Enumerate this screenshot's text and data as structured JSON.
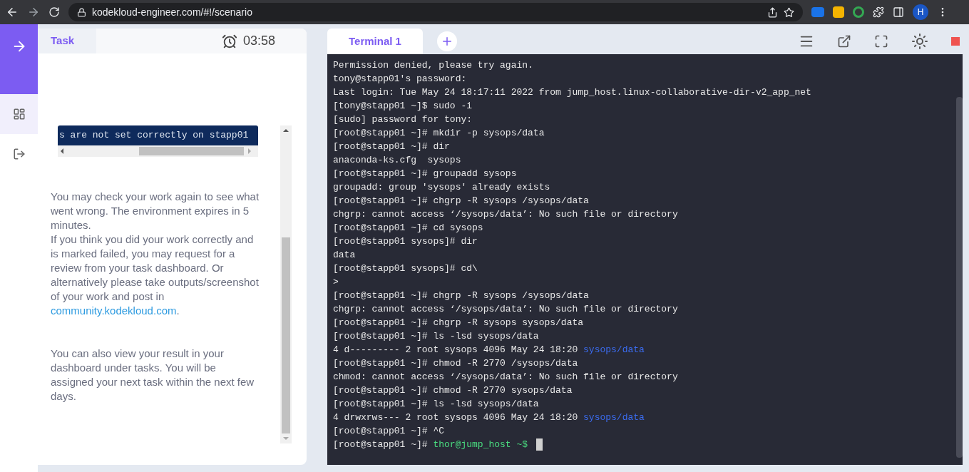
{
  "browser": {
    "url": "kodekloud-engineer.com/#!/scenario",
    "profile_initial": "H"
  },
  "task_panel": {
    "tab": {
      "label": "Task",
      "selected": true
    },
    "timer": "03:58",
    "code_snippet": "s are not set correctly on stapp01",
    "paragraph_groups": [
      [
        {
          "segments": [
            {
              "text": "You may check your work again to see what went wrong. The environment expires in 5 minutes.",
              "kind": "text"
            }
          ]
        },
        {
          "segments": [
            {
              "text": "If you think you did your work correctly and is marked failed, you may request for a review from your task dashboard. Or alternatively please take outputs/screenshot of your work and post in ",
              "kind": "text"
            },
            {
              "text": "community.kodekloud.com",
              "kind": "link"
            },
            {
              "text": ".",
              "kind": "text"
            }
          ]
        }
      ],
      [
        {
          "segments": [
            {
              "text": "You can also view your result in your dashboard under tasks. You will be assigned your next task within the next few days.",
              "kind": "text"
            }
          ]
        }
      ]
    ]
  },
  "terminal": {
    "cursor_visible": true,
    "tabs": [
      {
        "label": "Terminal 1",
        "selected": true
      }
    ],
    "lines": [
      [
        {
          "text": "Permission denied, please try again.",
          "kind": "plain"
        }
      ],
      [
        {
          "text": "tony@stapp01's password:",
          "kind": "plain"
        }
      ],
      [
        {
          "text": "Last login: Tue May 24 18:17:11 2022 from jump_host.linux-collaborative-dir-v2_app_net",
          "kind": "plain"
        }
      ],
      [
        {
          "text": "[tony@stapp01 ~]$ sudo -i",
          "kind": "plain"
        }
      ],
      [
        {
          "text": "[sudo] password for tony:",
          "kind": "plain"
        }
      ],
      [
        {
          "text": "[root@stapp01 ~]# mkdir -p sysops/data",
          "kind": "plain"
        }
      ],
      [
        {
          "text": "[root@stapp01 ~]# dir",
          "kind": "plain"
        }
      ],
      [
        {
          "text": "anaconda-ks.cfg  sysops",
          "kind": "plain"
        }
      ],
      [
        {
          "text": "[root@stapp01 ~]# groupadd sysops",
          "kind": "plain"
        }
      ],
      [
        {
          "text": "groupadd: group 'sysops' already exists",
          "kind": "plain"
        }
      ],
      [
        {
          "text": "[root@stapp01 ~]# chgrp -R sysops /sysops/data",
          "kind": "plain"
        }
      ],
      [
        {
          "text": "chgrp: cannot access ‘/sysops/data’: No such file or directory",
          "kind": "plain"
        }
      ],
      [
        {
          "text": "[root@stapp01 ~]# cd sysops",
          "kind": "plain"
        }
      ],
      [
        {
          "text": "[root@stapp01 sysops]# dir",
          "kind": "plain"
        }
      ],
      [
        {
          "text": "data",
          "kind": "plain"
        }
      ],
      [
        {
          "text": "[root@stapp01 sysops]# cd\\",
          "kind": "plain"
        }
      ],
      [
        {
          "text": ">",
          "kind": "plain"
        }
      ],
      [
        {
          "text": "[root@stapp01 ~]# chgrp -R sysops /sysops/data",
          "kind": "plain"
        }
      ],
      [
        {
          "text": "chgrp: cannot access ‘/sysops/data’: No such file or directory",
          "kind": "plain"
        }
      ],
      [
        {
          "text": "[root@stapp01 ~]# chgrp -R sysops sysops/data",
          "kind": "plain"
        }
      ],
      [
        {
          "text": "[root@stapp01 ~]# ls -lsd sysops/data",
          "kind": "plain"
        }
      ],
      [
        {
          "text": "4 d--------- 2 root sysops 4096 May 24 18:20 ",
          "kind": "plain"
        },
        {
          "text": "sysops/data",
          "kind": "dir"
        }
      ],
      [
        {
          "text": "[root@stapp01 ~]# chmod -R 2770 /sysops/data",
          "kind": "plain"
        }
      ],
      [
        {
          "text": "chmod: cannot access ‘/sysops/data’: No such file or directory",
          "kind": "plain"
        }
      ],
      [
        {
          "text": "[root@stapp01 ~]# chmod -R 2770 sysops/data",
          "kind": "plain"
        }
      ],
      [
        {
          "text": "[root@stapp01 ~]# ls -lsd sysops/data",
          "kind": "plain"
        }
      ],
      [
        {
          "text": "4 drwxrws--- 2 root sysops 4096 May 24 18:20 ",
          "kind": "plain"
        },
        {
          "text": "sysops/data",
          "kind": "dir"
        }
      ],
      [
        {
          "text": "[root@stapp01 ~]# ^C",
          "kind": "plain"
        }
      ],
      [
        {
          "text": "[root@stapp01 ~]# ",
          "kind": "plain"
        },
        {
          "text": "thor@jump_host ~$",
          "kind": "prompt"
        }
      ]
    ]
  }
}
